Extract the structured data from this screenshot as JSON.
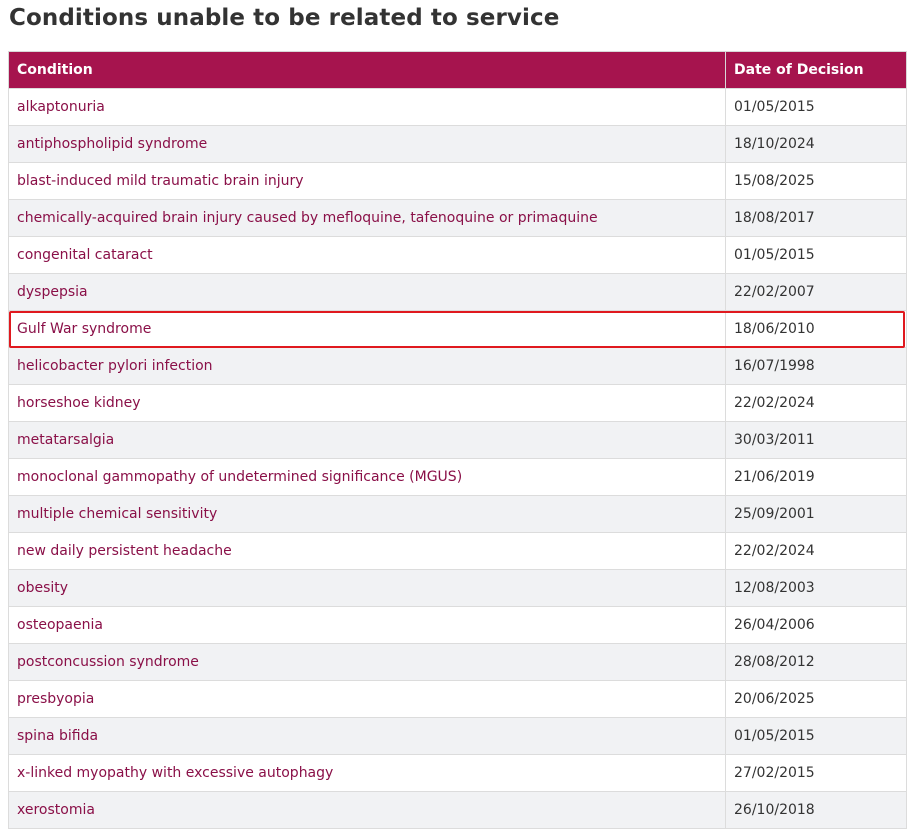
{
  "page": {
    "title": "Conditions unable to be related to service"
  },
  "table": {
    "headers": {
      "condition": "Condition",
      "date": "Date of Decision"
    },
    "rows": [
      {
        "condition": "alkaptonuria",
        "date": "01/05/2015"
      },
      {
        "condition": "antiphospholipid syndrome",
        "date": "18/10/2024"
      },
      {
        "condition": "blast-induced mild traumatic brain injury",
        "date": "15/08/2025"
      },
      {
        "condition": "chemically-acquired brain injury caused by mefloquine, tafenoquine or primaquine",
        "date": "18/08/2017"
      },
      {
        "condition": "congenital cataract",
        "date": "01/05/2015"
      },
      {
        "condition": "dyspepsia",
        "date": "22/02/2007"
      },
      {
        "condition": "Gulf War syndrome",
        "date": "18/06/2010"
      },
      {
        "condition": "helicobacter pylori infection",
        "date": "16/07/1998"
      },
      {
        "condition": "horseshoe kidney",
        "date": "22/02/2024"
      },
      {
        "condition": "metatarsalgia",
        "date": "30/03/2011"
      },
      {
        "condition": "monoclonal gammopathy of undetermined significance (MGUS)",
        "date": "21/06/2019"
      },
      {
        "condition": "multiple chemical sensitivity",
        "date": "25/09/2001"
      },
      {
        "condition": "new daily persistent headache",
        "date": "22/02/2024"
      },
      {
        "condition": "obesity",
        "date": "12/08/2003"
      },
      {
        "condition": "osteopaenia",
        "date": "26/04/2006"
      },
      {
        "condition": "postconcussion syndrome",
        "date": "28/08/2012"
      },
      {
        "condition": "presbyopia",
        "date": "20/06/2025"
      },
      {
        "condition": "spina bifida",
        "date": "01/05/2015"
      },
      {
        "condition": "x-linked myopathy with excessive autophagy",
        "date": "27/02/2015"
      },
      {
        "condition": "xerostomia",
        "date": "26/10/2018"
      }
    ],
    "highlighted_row": "Gulf War syndrome"
  },
  "colors": {
    "header_bg": "#a6144e",
    "header_text": "#ffffff",
    "link": "#8a1048",
    "row_alt_bg": "#f1f2f4",
    "highlight_border": "#e0191f"
  }
}
